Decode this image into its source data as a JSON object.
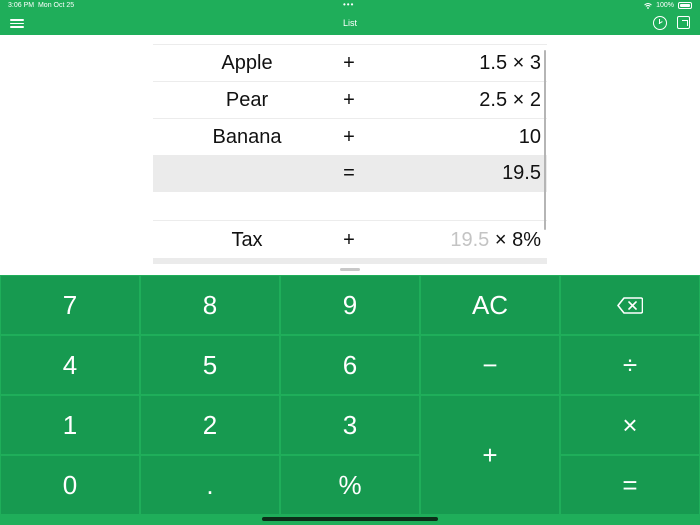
{
  "status": {
    "time": "3:06 PM",
    "date": "Mon Oct 25",
    "dots": "•••",
    "battery": "100%"
  },
  "nav": {
    "title": "List",
    "menu_icon": "menu-icon",
    "history_icon": "history-icon",
    "sheet_icon": "sheet-icon"
  },
  "rows": [
    {
      "name": "Apple",
      "op": "+",
      "value": "1.5 × 3"
    },
    {
      "name": "Pear",
      "op": "+",
      "value": "2.5 × 2"
    },
    {
      "name": "Banana",
      "op": "+",
      "value": "10"
    }
  ],
  "result": {
    "op": "=",
    "value": "19.5"
  },
  "tax": {
    "name": "Tax",
    "op": "+",
    "ref": "19.5",
    "value": " × 8%"
  },
  "keys": {
    "k7": "7",
    "k8": "8",
    "k9": "9",
    "ac": "AC",
    "k4": "4",
    "k5": "5",
    "k6": "6",
    "minus": "−",
    "divide": "÷",
    "k1": "1",
    "k2": "2",
    "k3": "3",
    "times": "×",
    "k0": "0",
    "dot": ".",
    "percent": "%",
    "plus": "+",
    "equals": "="
  },
  "colors": {
    "brand": "#1fae5a",
    "key": "#179a50",
    "result_row": "#ebebeb"
  }
}
